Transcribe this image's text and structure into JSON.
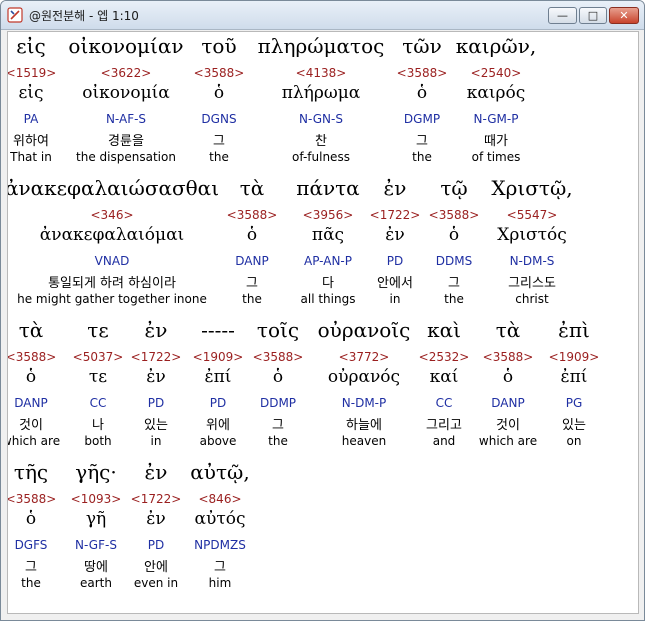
{
  "window": {
    "title": "@원전분해 - 엡 1:10",
    "minimize_label": "—",
    "maximize_label": "□",
    "close_label": "✕"
  },
  "rows": [
    [
      {
        "greek": "εἰς",
        "strong": "<1519>",
        "lemma": "εἰς",
        "parse": "PA",
        "korean": "위하여",
        "english": "That in"
      },
      {
        "greek": "οἰκονομίαν",
        "strong": "<3622>",
        "lemma": "οἰκονομία",
        "parse": "N-AF-S",
        "korean": "경륜을",
        "english": "the dispensation"
      },
      {
        "greek": "τοῦ",
        "strong": "<3588>",
        "lemma": "ὁ",
        "parse": "DGNS",
        "korean": "그",
        "english": "the"
      },
      {
        "greek": "πληρώματος",
        "strong": "<4138>",
        "lemma": "πλήρωμα",
        "parse": "N-GN-S",
        "korean": "찬",
        "english": "of-fulness"
      },
      {
        "greek": "τῶν",
        "strong": "<3588>",
        "lemma": "ὁ",
        "parse": "DGMP",
        "korean": "그",
        "english": "the"
      },
      {
        "greek": "καιρῶν,",
        "strong": "<2540>",
        "lemma": "καιρός",
        "parse": "N-GM-P",
        "korean": "때가",
        "english": "of times"
      }
    ],
    [
      {
        "greek": "ἀνακεφαλαιώσασθαι",
        "strong": "<346>",
        "lemma": "ἀνακεφαλαιόμαι",
        "parse": "VNAD",
        "korean": "통일되게 하려 하심이라",
        "english": "he might gather together inone"
      },
      {
        "greek": "τὰ",
        "strong": "<3588>",
        "lemma": "ὁ",
        "parse": "DANP",
        "korean": "그",
        "english": "the"
      },
      {
        "greek": "πάντα",
        "strong": "<3956>",
        "lemma": "πᾶς",
        "parse": "AP-AN-P",
        "korean": "다",
        "english": "all things"
      },
      {
        "greek": "ἐν",
        "strong": "<1722>",
        "lemma": "ἐν",
        "parse": "PD",
        "korean": "안에서",
        "english": "in"
      },
      {
        "greek": "τῷ",
        "strong": "<3588>",
        "lemma": "ὁ",
        "parse": "DDMS",
        "korean": "그",
        "english": "the"
      },
      {
        "greek": "Χριστῷ,",
        "strong": "<5547>",
        "lemma": "Χριστός",
        "parse": "N-DM-S",
        "korean": "그리스도",
        "english": "christ"
      }
    ],
    [
      {
        "greek": "τὰ",
        "strong": "<3588>",
        "lemma": "ὁ",
        "parse": "DANP",
        "korean": "것이",
        "english": "which are"
      },
      {
        "greek": "τε",
        "strong": "<5037>",
        "lemma": "τε",
        "parse": "CC",
        "korean": "나",
        "english": "both"
      },
      {
        "greek": "ἐν",
        "strong": "<1722>",
        "lemma": "ἐν",
        "parse": "PD",
        "korean": "있는",
        "english": "in"
      },
      {
        "greek": "-----",
        "strong": "<1909>",
        "lemma": "ἐπί",
        "parse": "PD",
        "korean": "위에",
        "english": "above"
      },
      {
        "greek": "τοῖς",
        "strong": "<3588>",
        "lemma": "ὁ",
        "parse": "DDMP",
        "korean": "그",
        "english": "the"
      },
      {
        "greek": "οὐρανοῖς",
        "strong": "<3772>",
        "lemma": "οὐρανός",
        "parse": "N-DM-P",
        "korean": "하늘에",
        "english": "heaven"
      },
      {
        "greek": "καὶ",
        "strong": "<2532>",
        "lemma": "καί",
        "parse": "CC",
        "korean": "그리고",
        "english": "and"
      },
      {
        "greek": "τὰ",
        "strong": "<3588>",
        "lemma": "ὁ",
        "parse": "DANP",
        "korean": "것이",
        "english": "which are"
      },
      {
        "greek": "ἐπὶ",
        "strong": "<1909>",
        "lemma": "ἐπί",
        "parse": "PG",
        "korean": "있는",
        "english": "on"
      }
    ],
    [
      {
        "greek": "τῆς",
        "strong": "<3588>",
        "lemma": "ὁ",
        "parse": "DGFS",
        "korean": "그",
        "english": "the"
      },
      {
        "greek": "γῆς·",
        "strong": "<1093>",
        "lemma": "γῆ",
        "parse": "N-GF-S",
        "korean": "땅에",
        "english": "earth"
      },
      {
        "greek": "ἐν",
        "strong": "<1722>",
        "lemma": "ἐν",
        "parse": "PD",
        "korean": "안에",
        "english": "even in"
      },
      {
        "greek": "αὐτῷ,",
        "strong": "<846>",
        "lemma": "αὐτός",
        "parse": "NPDMZS",
        "korean": "그",
        "english": "him"
      }
    ]
  ]
}
